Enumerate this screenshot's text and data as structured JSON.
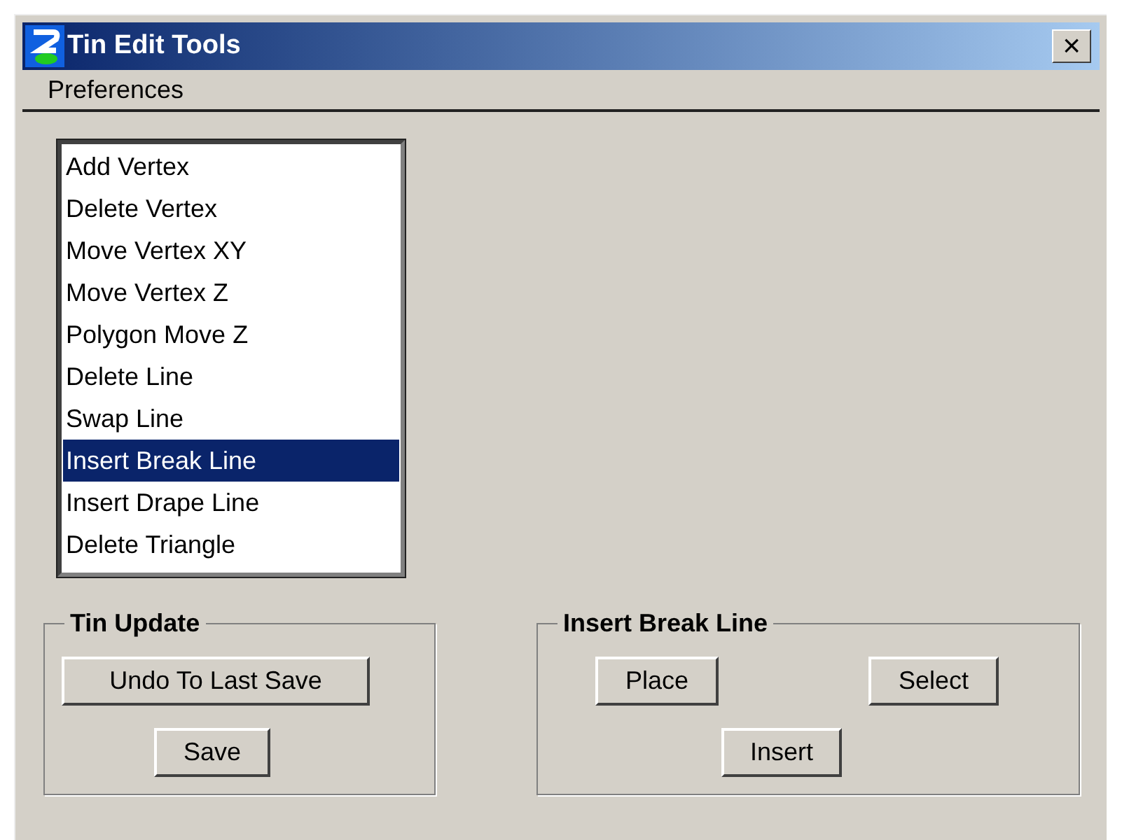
{
  "window": {
    "title": "Tin Edit Tools",
    "close": "×"
  },
  "menu": [
    "Preferences"
  ],
  "tools": [
    {
      "label": "Add Vertex",
      "selected": false
    },
    {
      "label": "Delete Vertex",
      "selected": false
    },
    {
      "label": "Move Vertex XY",
      "selected": false
    },
    {
      "label": "Move Vertex Z",
      "selected": false
    },
    {
      "label": "Polygon Move Z",
      "selected": false
    },
    {
      "label": "Delete Line",
      "selected": false
    },
    {
      "label": "Swap Line",
      "selected": false
    },
    {
      "label": "Insert Break Line",
      "selected": true
    },
    {
      "label": "Insert Drape Line",
      "selected": false
    },
    {
      "label": "Delete Triangle",
      "selected": false
    }
  ],
  "tin_update": {
    "title": "Tin Update",
    "buttons": [
      "Undo To Last Save",
      "Save"
    ]
  },
  "insert_break_line": {
    "title": "Insert Break Line",
    "buttons": [
      "Place",
      "Select",
      "Insert"
    ]
  }
}
